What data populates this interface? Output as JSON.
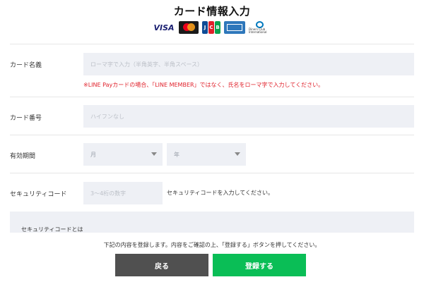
{
  "header": {
    "title": "カード情報入力",
    "card_brands": [
      "VISA",
      "MasterCard",
      "JCB",
      "AMERICAN EXPRESS",
      "Diners Club International"
    ],
    "visa_text": "VISA",
    "jcb_letters": [
      "J",
      "C",
      "B"
    ],
    "jcb_colors": [
      "#0e4c96",
      "#e0202a",
      "#0aa34f"
    ],
    "diners_text": "Diners Club International"
  },
  "form": {
    "card_name": {
      "label": "カード名義",
      "placeholder": "ローマ字で入力（半角英字、半角スペース）",
      "warning": "※LINE Payカードの場合、「LINE MEMBER」ではなく、氏名をローマ字で入力してください。"
    },
    "card_number": {
      "label": "カード番号",
      "placeholder": "ハイフンなし"
    },
    "expiry": {
      "label": "有効期間",
      "month_placeholder": "月",
      "year_placeholder": "年"
    },
    "security_code": {
      "label": "セキュリティコード",
      "placeholder": "3〜4桁の数字",
      "hint": "セキュリティコードを入力してください。"
    }
  },
  "info": {
    "title": "セキュリティコードとは"
  },
  "footer": {
    "notice": "下記の内容を登録します。内容をご確認の上、「登録する」ボタンを押してください。",
    "back_label": "戻る",
    "submit_label": "登録する"
  },
  "colors": {
    "accent_green": "#0abe56",
    "back_gray": "#505050",
    "warning_red": "#e0202a",
    "input_bg": "#eef0f5"
  }
}
